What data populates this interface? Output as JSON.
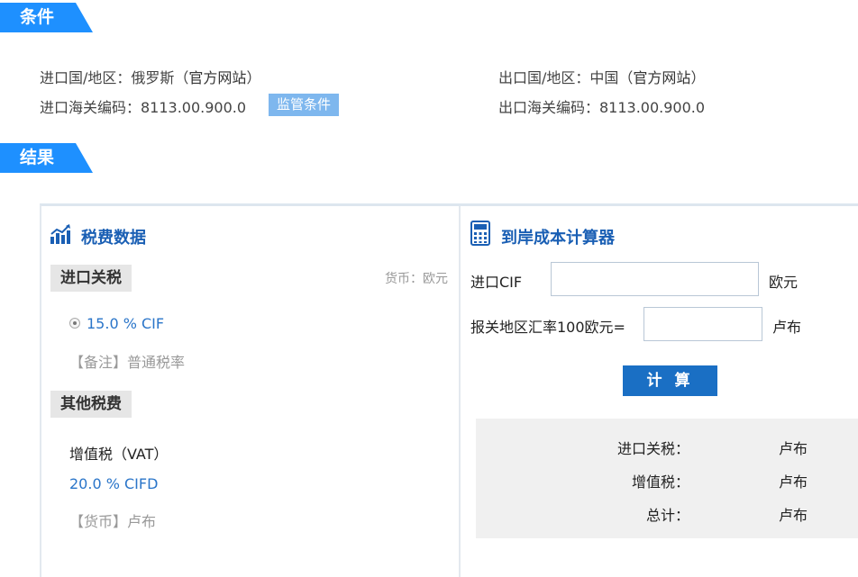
{
  "sections": {
    "conditions_label": "条件",
    "results_label": "结果"
  },
  "conditions": {
    "import_country_label": "进口国/地区：俄罗斯",
    "import_paren_open": "（",
    "import_official_site": "官方网站",
    "import_paren_close": "）",
    "export_country_label": "出口国/地区：中国",
    "export_paren_open": "（",
    "export_official_site": "官方网站",
    "export_paren_close": "）",
    "import_hs_code": "进口海关编码：8113.00.900.0",
    "export_hs_code": "出口海关编码：8113.00.900.0",
    "regulatory_button": "监管条件"
  },
  "tax_panel": {
    "title": "税费数据",
    "icon": "bar-chart-trend-icon",
    "currency_note": "货币：欧元",
    "import_duty_heading": "进口关税",
    "import_duty_rate": "15.0 % CIF",
    "import_duty_remark": "【备注】普通税率",
    "other_taxes_heading": "其他税费",
    "vat_label": "增值税（VAT）",
    "vat_rate": "20.0 % CIFD",
    "vat_currency": "【货币】卢布"
  },
  "calculator": {
    "title": "到岸成本计算器",
    "icon": "calculator-icon",
    "cif_label": "进口CIF",
    "cif_value": "",
    "cif_unit": "欧元",
    "rate_label": "报关地区汇率100欧元=",
    "rate_value": "",
    "rate_unit": "卢布",
    "calculate_button": "计 算",
    "results": [
      {
        "label": "进口关税：",
        "unit": "卢布"
      },
      {
        "label": "增值税：",
        "unit": "卢布"
      },
      {
        "label": "总计：",
        "unit": "卢布"
      }
    ]
  },
  "colors": {
    "flag": "#1e90ff",
    "title_blue": "#1a5fb4",
    "rate_blue": "#2a75c9",
    "button": "#1a6fc4",
    "badge": "#7eb7ee"
  }
}
